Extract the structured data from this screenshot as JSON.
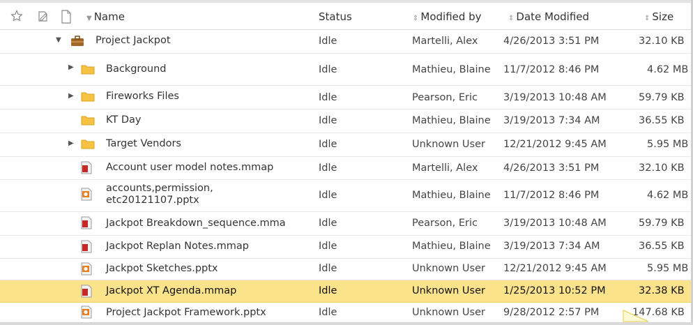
{
  "header": {
    "name": "Name",
    "status": "Status",
    "modified_by": "Modified by",
    "date_modified": "Date Modified",
    "size": "Size"
  },
  "icons": {
    "star": "star-icon",
    "checkout": "checkout-icon",
    "document": "document-icon",
    "sort_down": "sort-down-icon",
    "sort_toggle": "sort-toggle-icon"
  },
  "colors": {
    "selected_row": "#fbe38c",
    "folder": "#f5c341",
    "briefcase": "#a0662a",
    "mmap": "#c62828",
    "pptx": "#e67e22"
  },
  "rows": [
    {
      "name": "Project Jackpot",
      "status": "Idle",
      "modified_by": "Martelli, Alex",
      "date": "4/26/2013 3:51 PM",
      "size": "32.10 KB"
    },
    {
      "name": "Background",
      "status": "Idle",
      "modified_by": "Mathieu, Blaine",
      "date": "11/7/2012 8:46 PM",
      "size": "4.62 MB"
    },
    {
      "name": "Fireworks Files",
      "status": "Idle",
      "modified_by": "Pearson, Eric",
      "date": "3/19/2013 10:48 AM",
      "size": "59.79 KB"
    },
    {
      "name": "KT Day",
      "status": "Idle",
      "modified_by": "Mathieu, Blaine",
      "date": "3/19/2013 7:34 AM",
      "size": "36.55 KB"
    },
    {
      "name": "Target Vendors",
      "status": "Idle",
      "modified_by": "Unknown User",
      "date": "12/21/2012 9:45 AM",
      "size": "5.95 MB"
    },
    {
      "name": "Account user model notes.mmap",
      "status": "Idle",
      "modified_by": "Martelli, Alex",
      "date": "4/26/2013 3:51 PM",
      "size": "32.10 KB"
    },
    {
      "name_line1": "accounts,permission,",
      "name_line2": "etc20121107.pptx",
      "status": "Idle",
      "modified_by": "Mathieu, Blaine",
      "date": "11/7/2012 8:46 PM",
      "size": "4.62 MB"
    },
    {
      "name": "Jackpot Breakdown_sequence.mma",
      "status": "Idle",
      "modified_by": "Pearson, Eric",
      "date": "3/19/2013 10:48 AM",
      "size": "59.79 KB"
    },
    {
      "name": "Jackpot Replan Notes.mmap",
      "status": "Idle",
      "modified_by": "Mathieu, Blaine",
      "date": "3/19/2013 7:34 AM",
      "size": "36.55 KB"
    },
    {
      "name": "Jackpot Sketches.pptx",
      "status": "Idle",
      "modified_by": "Unknown User",
      "date": "12/21/2012 9:45 AM",
      "size": "5.95 MB"
    },
    {
      "name": "Jackpot XT Agenda.mmap",
      "status": "Idle",
      "modified_by": "Unknown User",
      "date": "1/25/2013 10:52 PM",
      "size": "32.38 KB",
      "selected": true
    },
    {
      "name": "Project Jackpot Framework.pptx",
      "status": "Idle",
      "modified_by": "Unknown User",
      "date": "9/28/2012 2:57 PM",
      "size": "147.68 KB"
    }
  ]
}
